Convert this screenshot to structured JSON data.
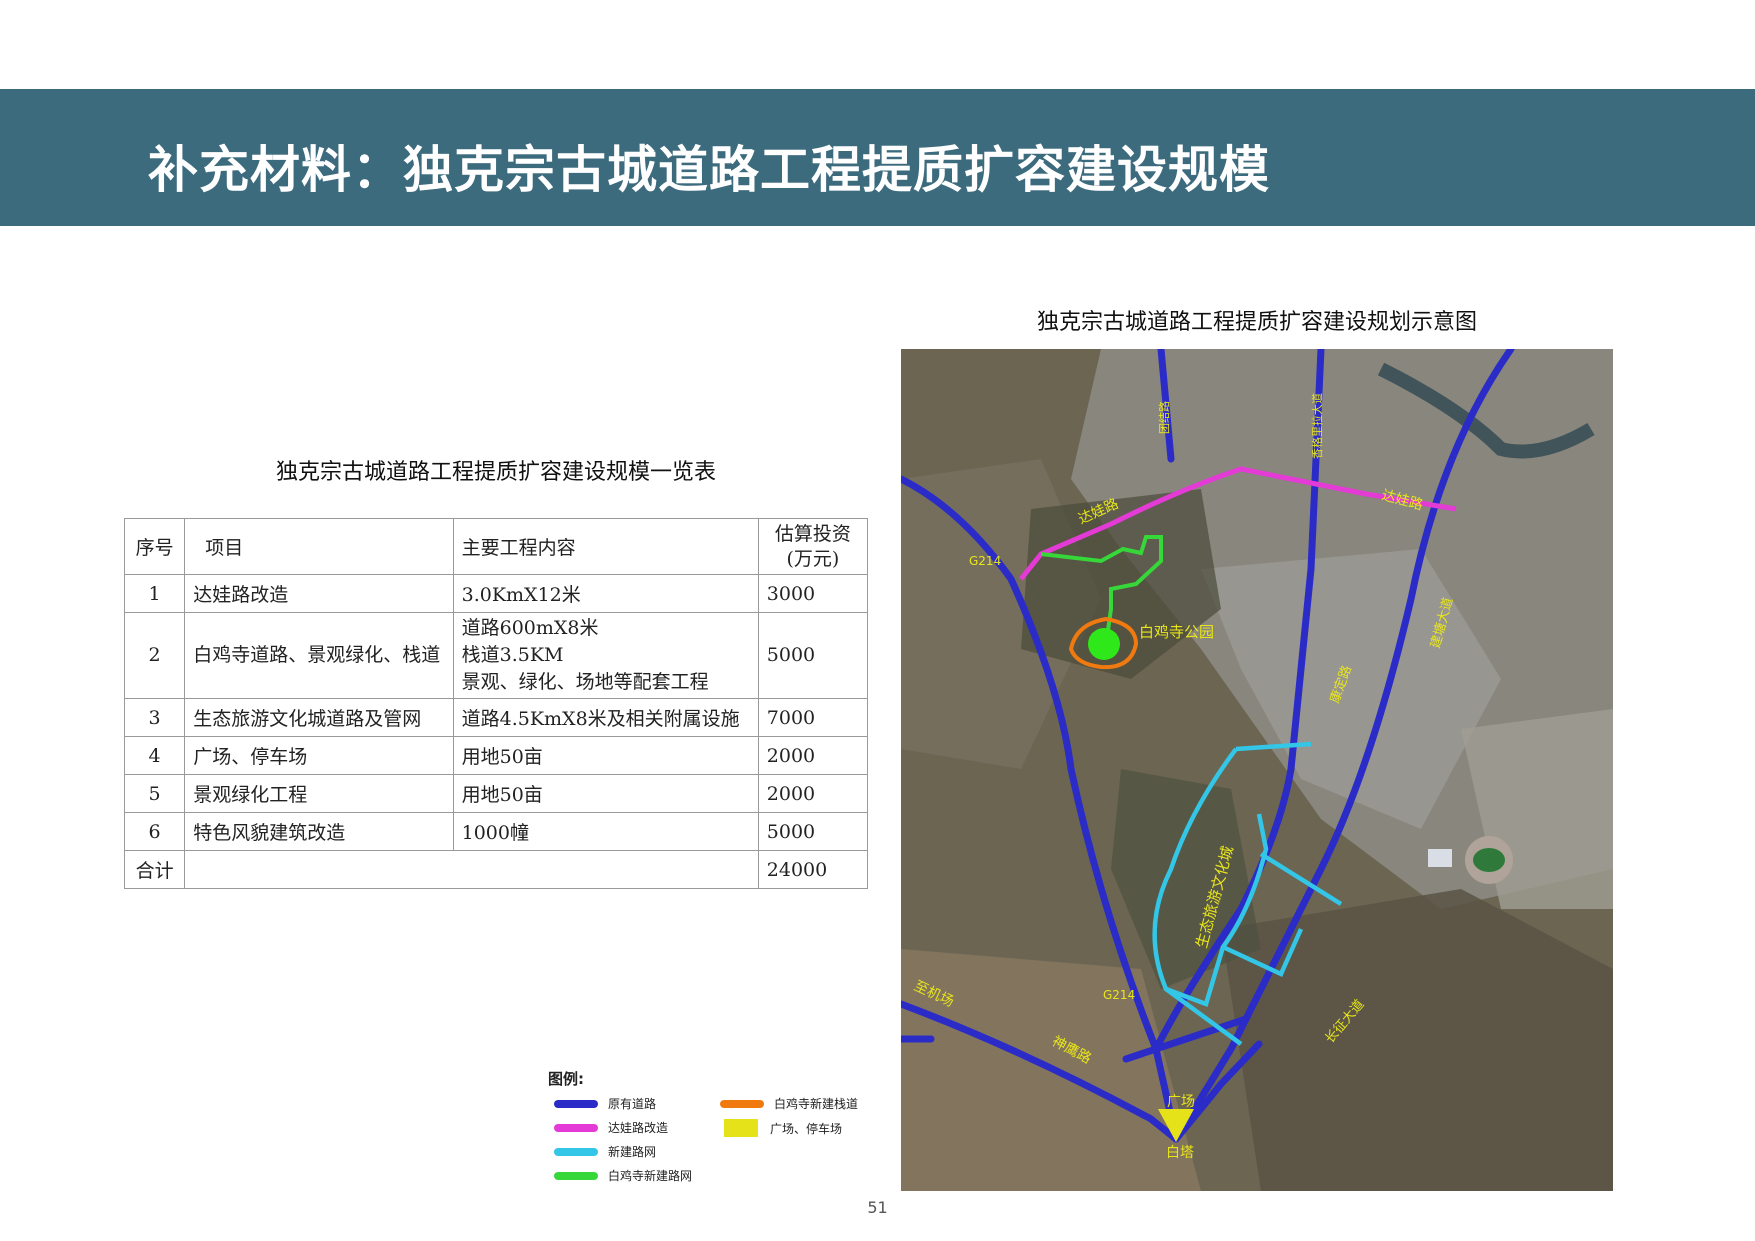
{
  "header": {
    "title": "补充材料：独克宗古城道路工程提质扩容建设规模"
  },
  "table": {
    "title": "独克宗古城道路工程提质扩容建设规模一览表",
    "headers": {
      "no": "序号",
      "item": "项目",
      "content": "主要工程内容",
      "invest_1": "估算投资",
      "invest_2": "(万元)"
    },
    "rows": [
      {
        "no": "1",
        "item": "达娃路改造",
        "content": [
          "3.0KmX12米"
        ],
        "invest": "3000"
      },
      {
        "no": "2",
        "item": "白鸡寺道路、景观绿化、栈道",
        "content": [
          "道路600mX8米",
          "栈道3.5KM",
          "景观、绿化、场地等配套工程"
        ],
        "invest": "5000"
      },
      {
        "no": "3",
        "item": "生态旅游文化城道路及管网",
        "content": [
          "道路4.5KmX8米及相关附属设施"
        ],
        "invest": "7000"
      },
      {
        "no": "4",
        "item": "广场、停车场",
        "content": [
          "用地50亩"
        ],
        "invest": "2000"
      },
      {
        "no": "5",
        "item": "景观绿化工程",
        "content": [
          "用地50亩"
        ],
        "invest": "2000"
      },
      {
        "no": "6",
        "item": "特色风貌建筑改造",
        "content": [
          "1000幢"
        ],
        "invest": "5000"
      }
    ],
    "total": {
      "label": "合计",
      "invest": "24000"
    }
  },
  "map": {
    "title": "独克宗古城道路工程提质扩容建设规划示意图",
    "labels": {
      "dawa_road": "达娃路",
      "dawa_road_2": "达娃路",
      "g214_upper": "G214",
      "g214_lower": "G214",
      "baiji_park": "白鸡寺公园",
      "eco_city": "生态旅游文化城",
      "airport_road": "至机场",
      "shenying_road": "神鹰路",
      "square": "广场",
      "baita": "白塔",
      "road_a": "团结路",
      "road_b": "香格里拉大道",
      "road_c": "建塘大道",
      "road_d": "长征大道",
      "road_e": "康定路"
    }
  },
  "legend": {
    "title": "图例:",
    "items": [
      {
        "label": "原有道路",
        "color": "#2b2bc8"
      },
      {
        "label": "达娃路改造",
        "color": "#e43ad6"
      },
      {
        "label": "新建路网",
        "color": "#33c6e6"
      },
      {
        "label": "白鸡寺新建路网",
        "color": "#35d838"
      },
      {
        "label": "白鸡寺新建栈道",
        "color": "#f07a10"
      },
      {
        "label": "广场、停车场",
        "color": "#e6e21a"
      }
    ]
  },
  "page_number": "51"
}
